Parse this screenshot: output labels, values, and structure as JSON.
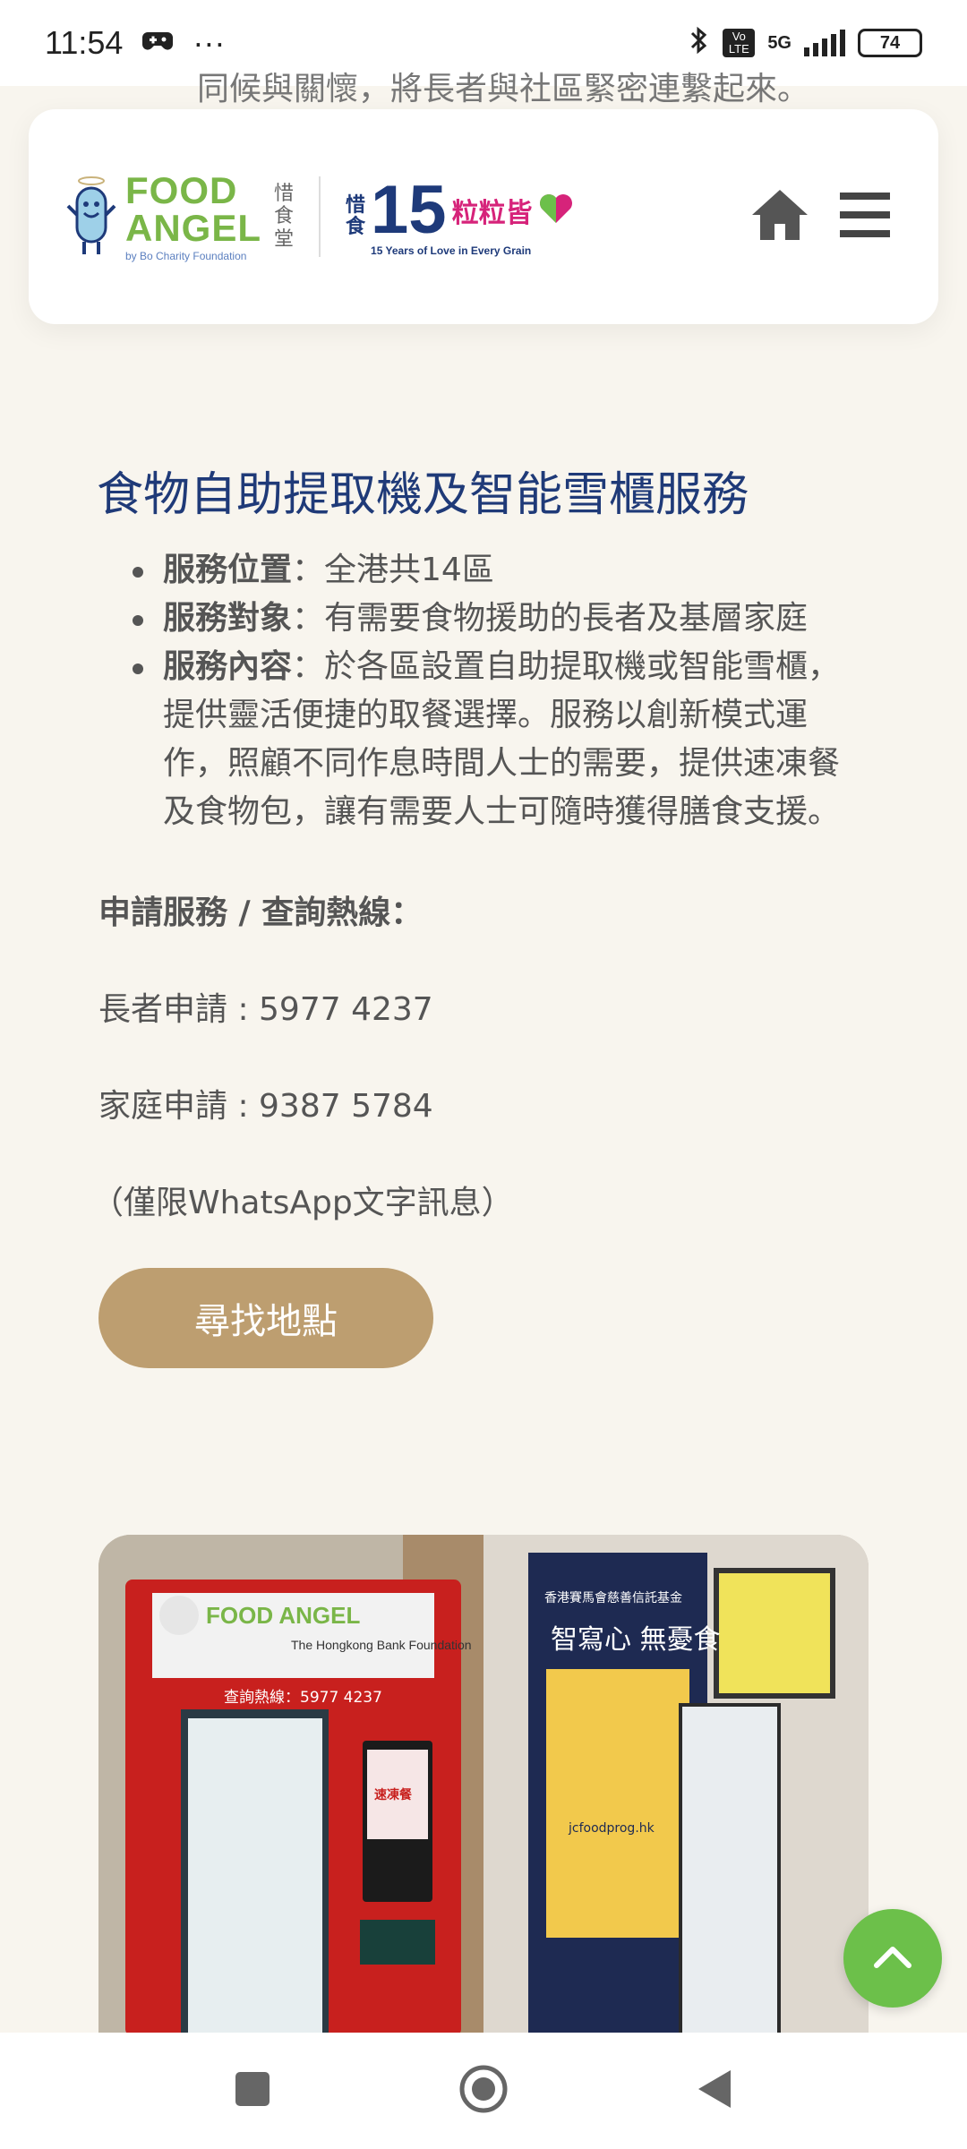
{
  "status_bar": {
    "time": "11:54",
    "more": "···",
    "network": "5G",
    "volte": "Vo LTE",
    "battery": "74"
  },
  "scrolled_text": "同候與關懷，將長者與社區緊密連繫起來。",
  "header": {
    "brand_food": "FOOD",
    "brand_angel": "ANGEL",
    "brand_sub": "by Bo Charity Foundation",
    "brand_cn": [
      "惜",
      "食",
      "堂"
    ],
    "anniv_cn": [
      "惜",
      "食"
    ],
    "anniv_num": "15",
    "anniv_words": "粒粒皆",
    "anniv_sub": "15 Years of Love in Every Grain",
    "icons": [
      "home-icon",
      "menu-icon"
    ]
  },
  "content": {
    "title": "食物自助提取機及智能雪櫃服務",
    "items": [
      {
        "label": "服務位置",
        "sep": "：",
        "text": "全港共14區"
      },
      {
        "label": "服務對象",
        "sep": "：",
        "text": "有需要食物援助的長者及基層家庭"
      },
      {
        "label": "服務內容",
        "sep": "：",
        "text": "於各區設置自助提取機或智能雪櫃，提供靈活便捷的取餐選擇。服務以創新模式運作，照顧不同作息時間人士的需要，提供速凍餐及食物包，讓有需要人士可隨時獲得膳食支援。"
      }
    ],
    "hotline_title": "申請服務 / 查詢熱線：",
    "elderly": "長者申請 : 5977 4237",
    "family": "家庭申請 : 9387 5784",
    "note": "（僅限WhatsApp文字訊息）",
    "find_button": "尋找地點"
  },
  "photo": {
    "left_logo": "FOOD ANGEL",
    "left_bank": "The Hongkong Bank Foundation",
    "left_hotline": "查詢熱線：5977 4237",
    "left_screen": "速凍餐",
    "right_heading": "香港賽馬會慈善信託基金",
    "right_title": "智寫心 無憂食",
    "right_site": "jcfoodprog.hk"
  },
  "colors": {
    "title": "#1f3a78",
    "button": "#bd9e70",
    "scroll_top": "#6cc04a",
    "background": "#f8f5ee"
  }
}
